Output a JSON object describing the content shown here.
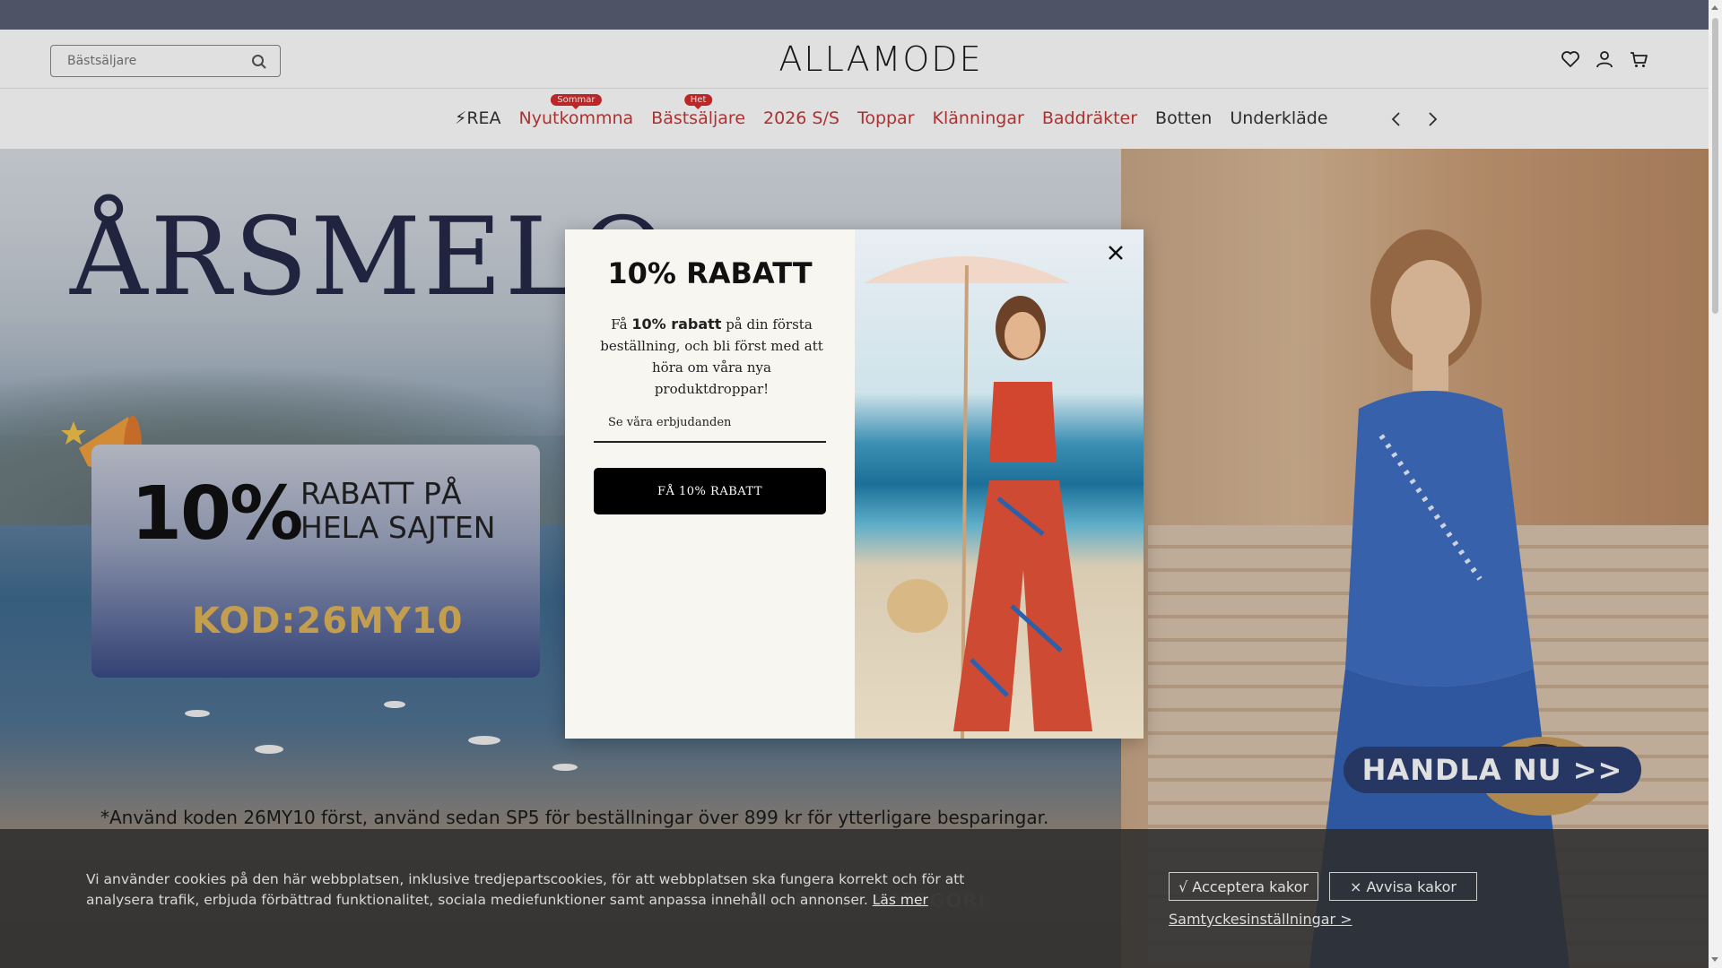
{
  "header": {
    "search_placeholder": "Bästsäljare",
    "logo": "ALLAMODE",
    "icons": [
      "heart-icon",
      "user-icon",
      "cart-icon"
    ]
  },
  "nav": {
    "items": [
      {
        "label": "⚡REA",
        "badge": null
      },
      {
        "label": "Nyutkommna",
        "badge": "Sommar"
      },
      {
        "label": "Bästsäljare",
        "badge": "Het"
      },
      {
        "label": "2026 S/S",
        "badge": null
      },
      {
        "label": "Toppar",
        "badge": null
      },
      {
        "label": "Klänningar",
        "badge": null
      },
      {
        "label": "Baddräkter",
        "badge": null
      },
      {
        "label": "Botten",
        "badge": null
      },
      {
        "label": "Underkläde",
        "badge": null
      }
    ]
  },
  "hero": {
    "title": "ÅRSMELO",
    "promo_percent": "10%",
    "promo_text": "RABATT PÅ\nHELA SAJTEN",
    "promo_code": "KOD:26MY10",
    "cta": "HANDLA NU >>",
    "disclaimer": "*Använd koden 26MY10 först, använd  sedan SP5 för beställningar över 899 kr för ytterligare besparingar."
  },
  "popup": {
    "title": "10% RABATT",
    "desc_prefix": "Få ",
    "desc_bold": "10% rabatt",
    "desc_suffix": " på din första beställning, och bli först med att höra om våra nya produktdroppar!",
    "email_placeholder": "Se våra erbjudanden",
    "cta": "FÅ 10% RABATT"
  },
  "section": {
    "heading": "KÖP EFTER KATEGORI"
  },
  "cookie": {
    "text": "Vi använder cookies på den här webbplatsen, inklusive tredjepartscookies, för att webbplatsen ska fungera korrekt och för att analysera trafik, erbjuda förbättrad funktionalitet, sociala mediefunktioner samt anpassa innehåll och annonser.",
    "link": "Läs mer",
    "accept": "√ Acceptera kakor",
    "reject": "× Avvisa kakor",
    "settings": "Samtyckesinställningar >"
  },
  "colors": {
    "nav_red": "#c43a3a",
    "badge_red": "#d62c2c",
    "hero_cta": "#2c3f72",
    "code_gold": "#e0b45a"
  }
}
